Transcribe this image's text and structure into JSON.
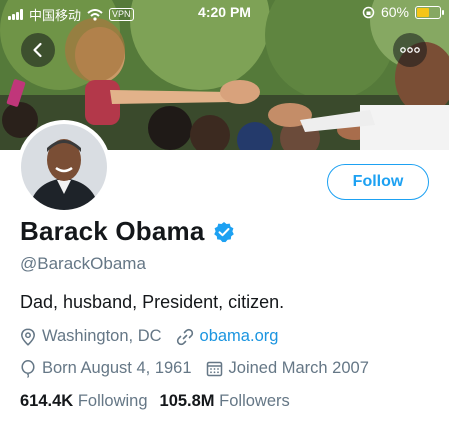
{
  "status_bar": {
    "carrier": "中国移动",
    "vpn": "VPN",
    "time": "4:20 PM",
    "battery": "60%",
    "battery_level": 0.6,
    "battery_color": "#f5c518"
  },
  "header": {
    "back_icon": "chevron-left-icon",
    "more_icon": "more-dots-icon"
  },
  "profile": {
    "name": "Barack Obama",
    "verified_icon": "verified-badge-icon",
    "handle": "@BarackObama",
    "bio": "Dad, husband, President, citizen.",
    "location": "Washington, DC",
    "website": "obama.org",
    "birthday": "Born August 4, 1961",
    "joined": "Joined March 2007",
    "following_count": "614.4K",
    "following_label": "Following",
    "followers_count": "105.8M",
    "followers_label": "Followers"
  },
  "actions": {
    "follow_label": "Follow"
  },
  "colors": {
    "accent": "#1da1f2",
    "link": "#1b95e0",
    "muted": "#657786",
    "text": "#14171a"
  }
}
